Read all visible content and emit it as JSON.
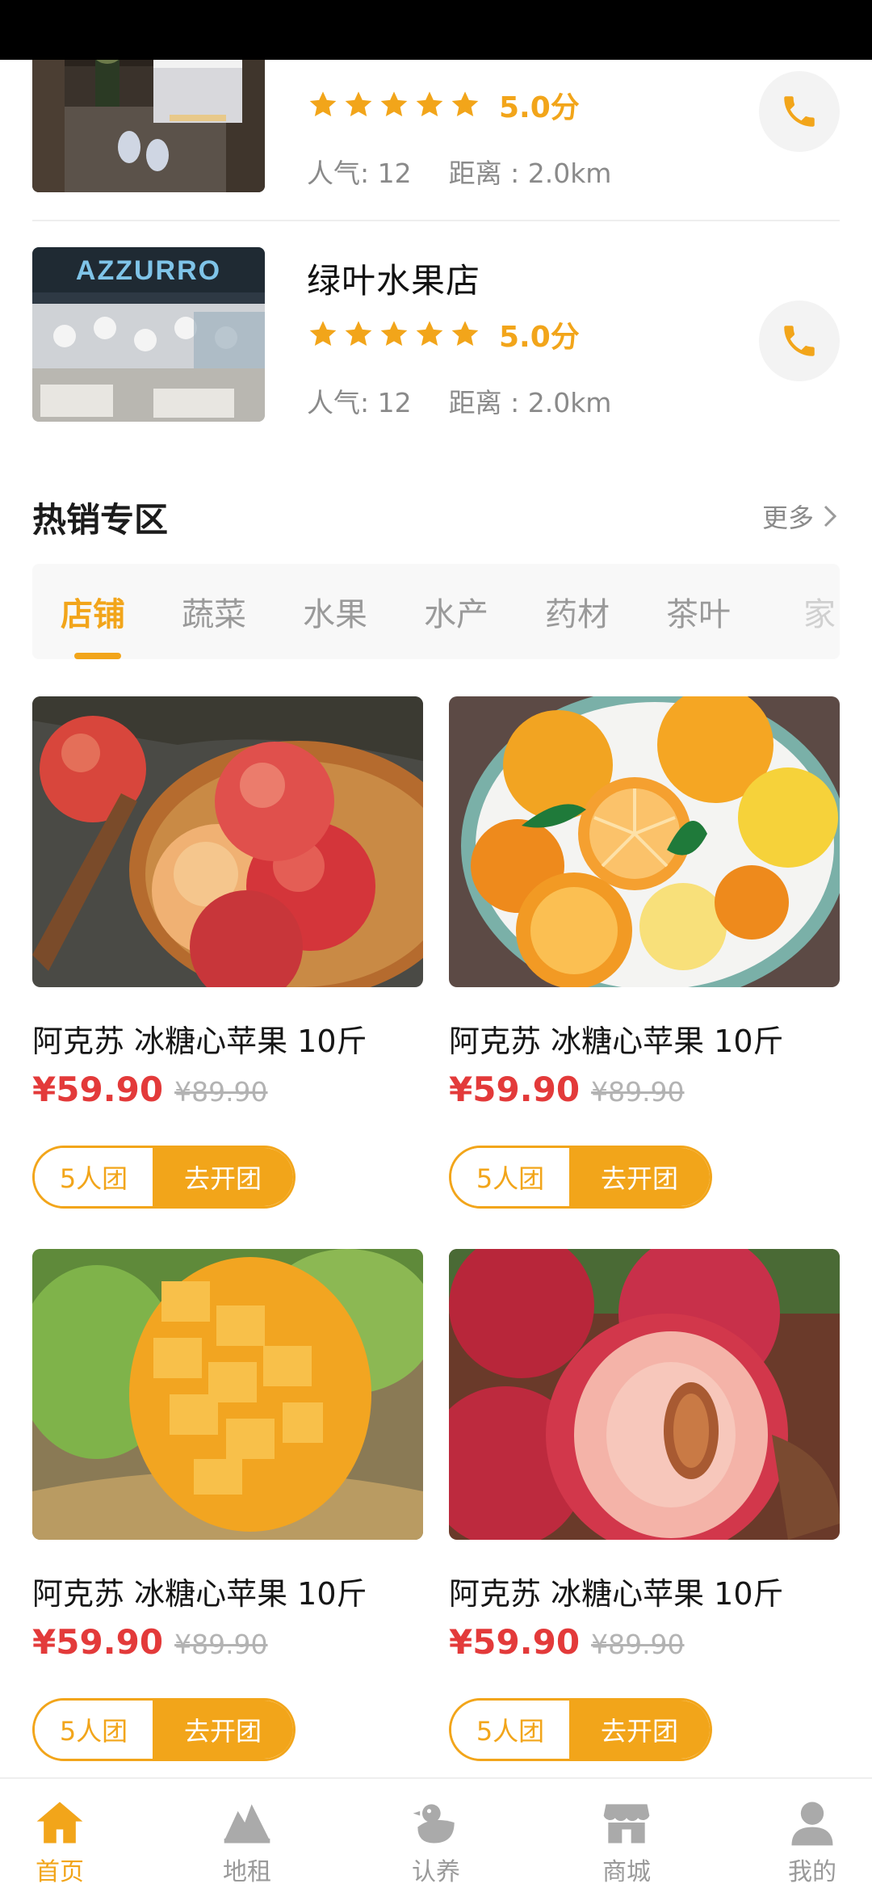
{
  "shops": [
    {
      "name": "",
      "score": "5.0分",
      "popularity": "人气: 12",
      "distance": "距离 : 2.0km"
    },
    {
      "name": "绿叶水果店",
      "score": "5.0分",
      "popularity": "人气: 12",
      "distance": "距离 : 2.0km",
      "sign_text": "AZZURRO"
    }
  ],
  "hot_section": {
    "title": "热销专区",
    "more": "更多"
  },
  "categories": [
    "店铺",
    "蔬菜",
    "水果",
    "水产",
    "药材",
    "茶叶",
    "家"
  ],
  "active_category": "店铺",
  "products": [
    {
      "name": "阿克苏 冰糖心苹果 10斤",
      "price": "¥59.90",
      "old_price": "¥89.90",
      "group_size": "5人团",
      "action": "去开团",
      "image": "apples-in-basket"
    },
    {
      "name": "阿克苏 冰糖心苹果 10斤",
      "price": "¥59.90",
      "old_price": "¥89.90",
      "group_size": "5人团",
      "action": "去开团",
      "image": "oranges-on-plate"
    },
    {
      "name": "阿克苏 冰糖心苹果 10斤",
      "price": "¥59.90",
      "old_price": "¥89.90",
      "group_size": "5人团",
      "action": "去开团",
      "image": "cut-mango"
    },
    {
      "name": "阿克苏 冰糖心苹果 10斤",
      "price": "¥59.90",
      "old_price": "¥89.90",
      "group_size": "5人团",
      "action": "去开团",
      "image": "halved-nectarine"
    }
  ],
  "tab_bar": {
    "active": "首页",
    "items": [
      {
        "label": "首页",
        "icon": "home-icon"
      },
      {
        "label": "地租",
        "icon": "mountain-icon"
      },
      {
        "label": "认养",
        "icon": "chick-icon"
      },
      {
        "label": "商城",
        "icon": "store-icon"
      },
      {
        "label": "我的",
        "icon": "user-icon"
      }
    ]
  },
  "colors": {
    "accent": "#f2a51a",
    "price": "#e33a3a",
    "muted": "#8a8a8a"
  }
}
